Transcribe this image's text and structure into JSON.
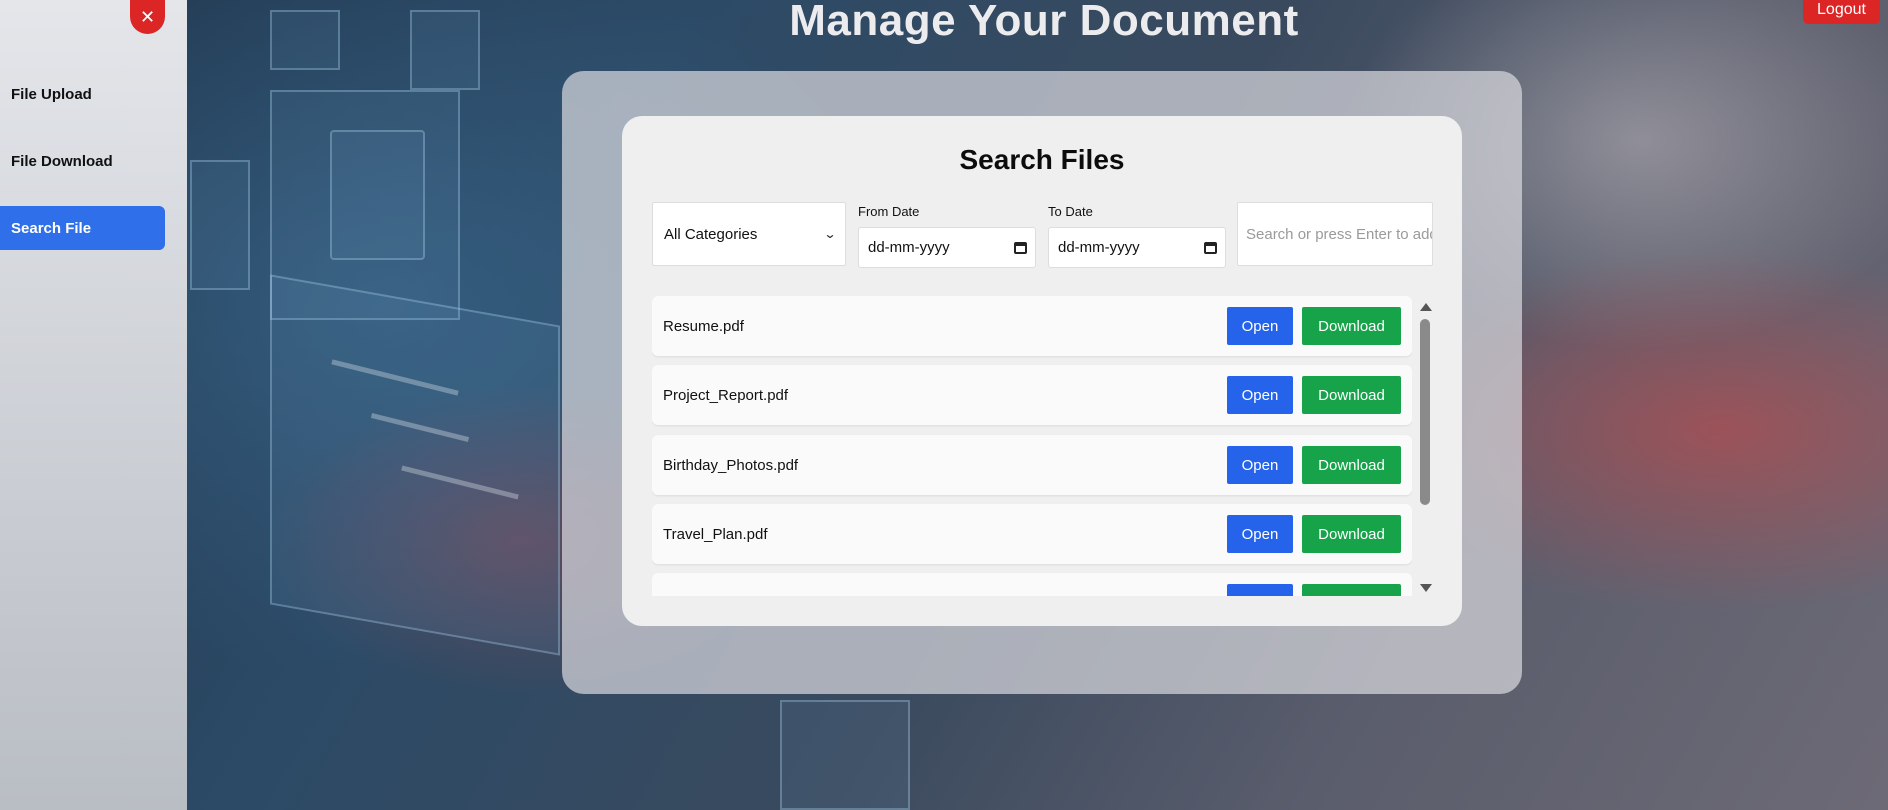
{
  "header": {
    "title": "Manage Your Document",
    "logout_label": "Logout"
  },
  "sidebar": {
    "close_icon": "close-icon",
    "items": [
      {
        "label": "File Upload",
        "active": false
      },
      {
        "label": "File Download",
        "active": false
      },
      {
        "label": "Search File",
        "active": true
      }
    ]
  },
  "search_panel": {
    "title": "Search Files",
    "category": {
      "selected": "All Categories"
    },
    "from_date": {
      "label": "From Date",
      "value": "dd-mm-yyyy"
    },
    "to_date": {
      "label": "To Date",
      "value": "dd-mm-yyyy"
    },
    "search": {
      "placeholder": "Search or press Enter to add"
    }
  },
  "files": [
    {
      "name": "Resume.pdf",
      "open_label": "Open",
      "download_label": "Download"
    },
    {
      "name": "Project_Report.pdf",
      "open_label": "Open",
      "download_label": "Download"
    },
    {
      "name": "Birthday_Photos.pdf",
      "open_label": "Open",
      "download_label": "Download"
    },
    {
      "name": "Travel_Plan.pdf",
      "open_label": "Open",
      "download_label": "Download"
    },
    {
      "name": "",
      "open_label": "",
      "download_label": ""
    }
  ],
  "colors": {
    "accent_blue": "#2563eb",
    "download_green": "#16a34a",
    "danger_red": "#dc2626",
    "sidebar_active": "#2f6fe9"
  }
}
